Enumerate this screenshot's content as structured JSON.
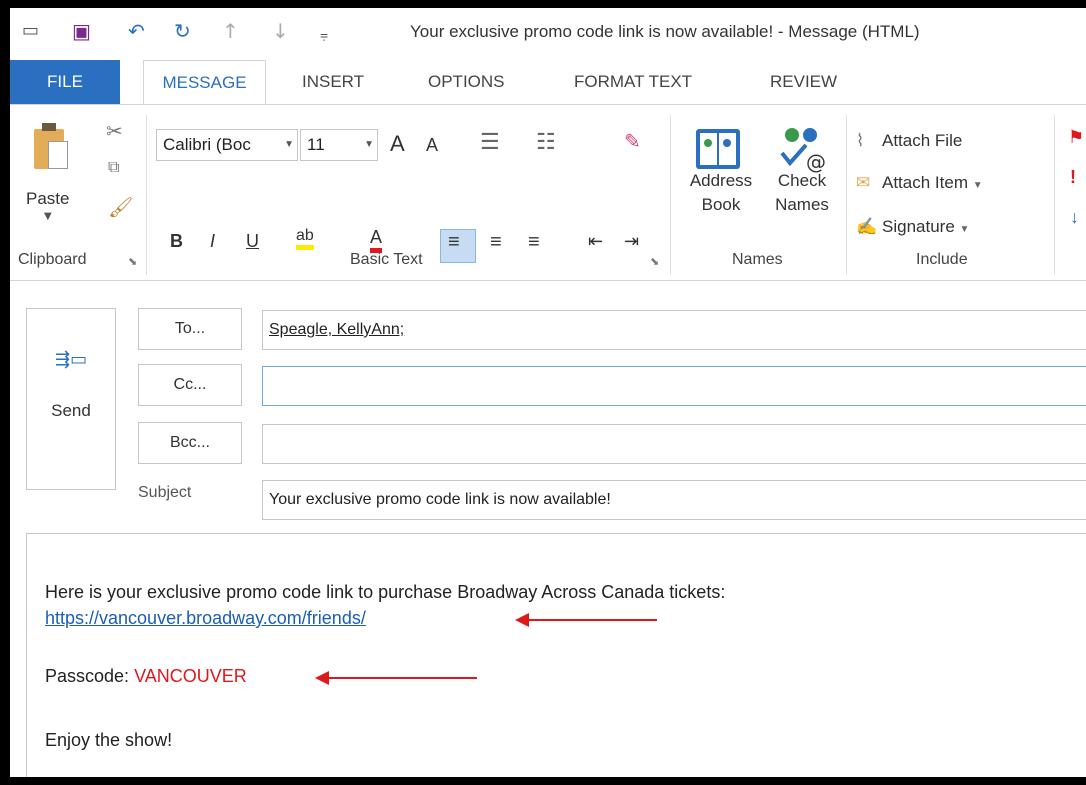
{
  "window": {
    "title": "Your exclusive promo code link is now available!  - Message (HTML)"
  },
  "tabs": [
    {
      "label": "FILE"
    },
    {
      "label": "MESSAGE"
    },
    {
      "label": "INSERT"
    },
    {
      "label": "OPTIONS"
    },
    {
      "label": "FORMAT TEXT"
    },
    {
      "label": "REVIEW"
    }
  ],
  "ribbon": {
    "clipboard": {
      "paste_label": "Paste",
      "group_label": "Clipboard"
    },
    "basic_text": {
      "font_name": "Calibri (Boc",
      "font_size": "11",
      "group_label": "Basic Text"
    },
    "names": {
      "address_book_line1": "Address",
      "address_book_line2": "Book",
      "check_names_line1": "Check",
      "check_names_line2": "Names",
      "group_label": "Names"
    },
    "include": {
      "attach_file": "Attach File",
      "attach_item": "Attach Item",
      "signature": "Signature",
      "group_label": "Include"
    }
  },
  "compose": {
    "send_label": "Send",
    "to_label": "To...",
    "cc_label": "Cc...",
    "bcc_label": "Bcc...",
    "to_value": "Speagle, KellyAnn;",
    "cc_value": "",
    "bcc_value": "",
    "subject_label": "Subject",
    "subject_value": "Your exclusive promo code link is now available!"
  },
  "message": {
    "line1": "Here is your exclusive promo code link to purchase Broadway Across Canada tickets:",
    "link": "https://vancouver.broadway.com/friends/",
    "passcode_label": "Passcode: ",
    "passcode_value": "VANCOUVER",
    "closing": "Enjoy the show!"
  },
  "colors": {
    "accent": "#2b6fc0",
    "annotation_red": "#e0181b",
    "link": "#1a5fb4"
  }
}
